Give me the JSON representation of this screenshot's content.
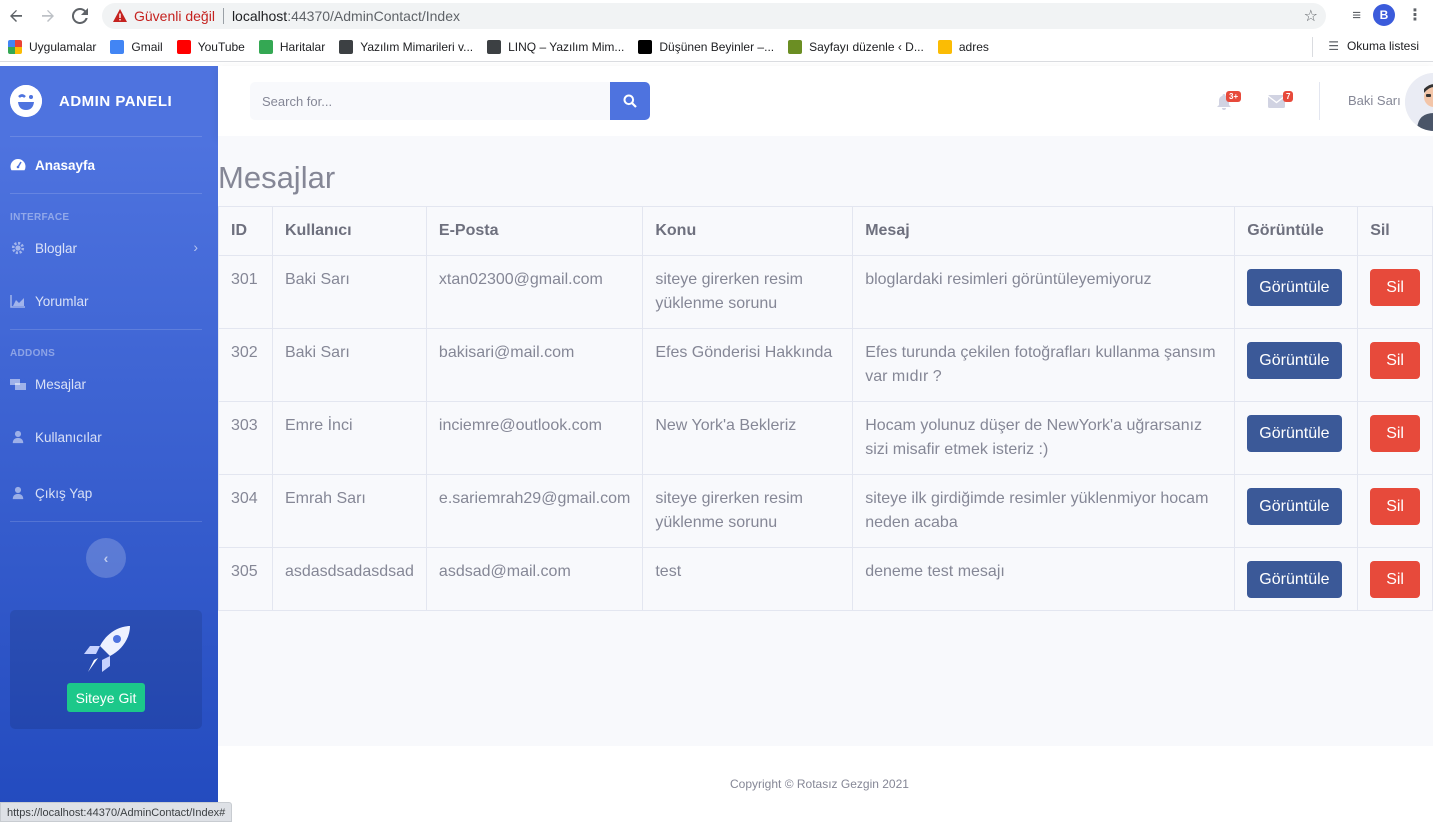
{
  "browser": {
    "security_label": "Güvenli değil",
    "url_host": "localhost",
    "url_rest": ":44370/AdminContact/Index",
    "profile_initial": "B",
    "bookmarks": [
      {
        "label": "Uygulamalar",
        "color": "#ea4335"
      },
      {
        "label": "Gmail",
        "color": "#4285f4"
      },
      {
        "label": "YouTube",
        "color": "#ff0000"
      },
      {
        "label": "Haritalar",
        "color": "#34a853"
      },
      {
        "label": "Yazılım Mimarileri v...",
        "color": "#3c4043"
      },
      {
        "label": "LINQ – Yazılım Mim...",
        "color": "#3c4043"
      },
      {
        "label": "Düşünen Beyinler –...",
        "color": "#000000"
      },
      {
        "label": "Sayfayı düzenle ‹ D...",
        "color": "#6b8e23"
      },
      {
        "label": "adres",
        "color": "#fbbc04"
      }
    ],
    "reading_list": "Okuma listesi",
    "status_url": "https://localhost:44370/AdminContact/Index#"
  },
  "sidebar": {
    "brand": "ADMIN PANELI",
    "home": "Anasayfa",
    "heading_interface": "INTERFACE",
    "blogs": "Bloglar",
    "comments": "Yorumlar",
    "heading_addons": "ADDONS",
    "messages": "Mesajlar",
    "users": "Kullanıcılar",
    "logout": "Çıkış Yap",
    "toggle_symbol": "‹",
    "promo_button": "Siteye Git"
  },
  "topbar": {
    "search_placeholder": "Search for...",
    "alerts_badge": "3+",
    "messages_badge": "7",
    "username": "Baki Sarı"
  },
  "main": {
    "title": "Mesajlar",
    "columns": [
      "ID",
      "Kullanıcı",
      "E-Posta",
      "Konu",
      "Mesaj",
      "Görüntüle",
      "Sil"
    ],
    "view_label": "Görüntüle",
    "delete_label": "Sil",
    "rows": [
      {
        "id": "301",
        "user": "Baki Sarı",
        "email": "xtan02300@gmail.com",
        "subject": "siteye girerken resim yüklenme sorunu",
        "message": "bloglardaki resimleri görüntüleyemiyoruz"
      },
      {
        "id": "302",
        "user": "Baki Sarı",
        "email": "bakisari@mail.com",
        "subject": "Efes Gönderisi Hakkında",
        "message": "Efes turunda çekilen fotoğrafları kullanma şansım var mıdır ?"
      },
      {
        "id": "303",
        "user": "Emre İnci",
        "email": "inciemre@outlook.com",
        "subject": "New York'a Bekleriz",
        "message": "Hocam yolunuz düşer de NewYork'a uğrarsanız sizi misafir etmek isteriz :)"
      },
      {
        "id": "304",
        "user": "Emrah Sarı",
        "email": "e.sariemrah29@gmail.com",
        "subject": "siteye girerken resim yüklenme sorunu",
        "message": "siteye ilk girdiğimde resimler yüklenmiyor hocam neden acaba"
      },
      {
        "id": "305",
        "user": "asdasdsadasdsad",
        "email": "asdsad@mail.com",
        "subject": "test",
        "message": "deneme test mesajı"
      }
    ]
  },
  "footer": {
    "copyright": "Copyright © Rotasız Gezgin 2021"
  }
}
